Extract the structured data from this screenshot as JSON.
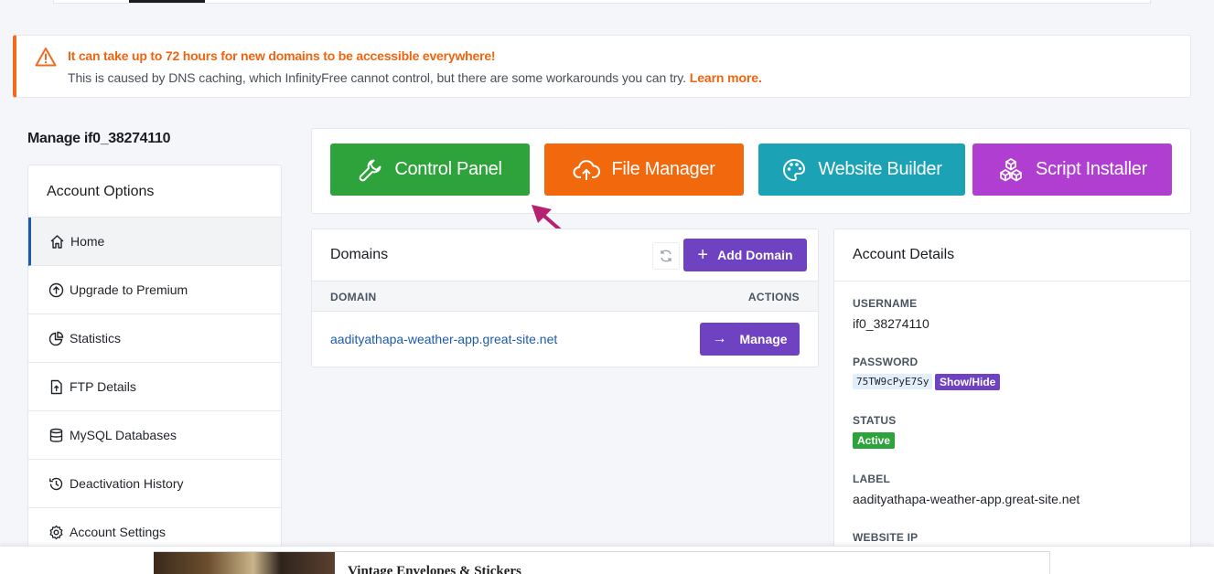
{
  "alert": {
    "title": "It can take up to 72 hours for new domains to be accessible everywhere!",
    "body": "This is caused by DNS caching, which InfinityFree cannot control, but there are some workarounds you can try.",
    "link": "Learn more."
  },
  "manage_title": "Manage if0_38274110",
  "account_options": {
    "heading": "Account Options",
    "items": [
      {
        "label": "Home",
        "icon": "home-icon",
        "active": true
      },
      {
        "label": "Upgrade to Premium",
        "icon": "upgrade-icon"
      },
      {
        "label": "Statistics",
        "icon": "pie-chart-icon"
      },
      {
        "label": "FTP Details",
        "icon": "file-upload-icon"
      },
      {
        "label": "MySQL Databases",
        "icon": "database-icon"
      },
      {
        "label": "Deactivation History",
        "icon": "history-icon"
      },
      {
        "label": "Account Settings",
        "icon": "gear-icon"
      }
    ]
  },
  "tools": {
    "control_panel": "Control Panel",
    "file_manager": "File Manager",
    "website_builder": "Website Builder",
    "script_installer": "Script Installer"
  },
  "domains": {
    "title": "Domains",
    "add_button": "Add Domain",
    "col_domain": "DOMAIN",
    "col_actions": "ACTIONS",
    "rows": [
      {
        "domain": "aadityathapa-weather-app.great-site.net",
        "action": "Manage"
      }
    ]
  },
  "account_details": {
    "title": "Account Details",
    "username_label": "USERNAME",
    "username": "if0_38274110",
    "password_label": "PASSWORD",
    "password": "75TW9cPyE7Sy",
    "show_hide": "Show/Hide",
    "status_label": "STATUS",
    "status": "Active",
    "label_label": "LABEL",
    "label": "aadityathapa-weather-app.great-site.net",
    "website_ip_label": "WEBSITE IP"
  },
  "ad": {
    "text": "Vintage Envelopes & Stickers"
  },
  "colors": {
    "accent_orange": "#f26b1d",
    "purple": "#6f42c1",
    "green": "#2ea33b",
    "teal": "#1ba3b5",
    "magenta": "#b03fd1",
    "link_blue": "#1d5ba8",
    "arrow": "#b5226f"
  }
}
